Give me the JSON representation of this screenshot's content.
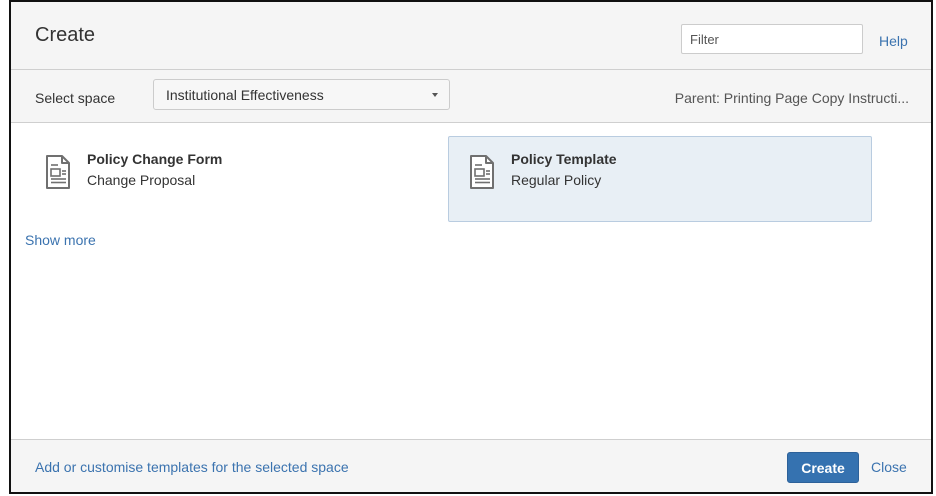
{
  "dialog": {
    "title": "Create",
    "filter": {
      "value": "",
      "placeholder": "Filter"
    },
    "help_label": "Help"
  },
  "space_bar": {
    "label": "Select space",
    "selected_space": "Institutional Effectiveness",
    "parent_text": "Parent: Printing Page Copy Instructi..."
  },
  "templates": [
    {
      "name": "Policy Change Form",
      "description": "Change Proposal",
      "icon": "document-template-icon",
      "selected": false
    },
    {
      "name": "Policy Template",
      "description": "Regular Policy",
      "icon": "document-template-icon",
      "selected": true
    }
  ],
  "show_more_label": "Show more",
  "footer": {
    "customise_link": "Add or customise templates for the selected space",
    "create_label": "Create",
    "close_label": "Close"
  },
  "colors": {
    "link": "#3b73af",
    "primary_button": "#3572b0",
    "selected_bg": "#e8eff5"
  }
}
